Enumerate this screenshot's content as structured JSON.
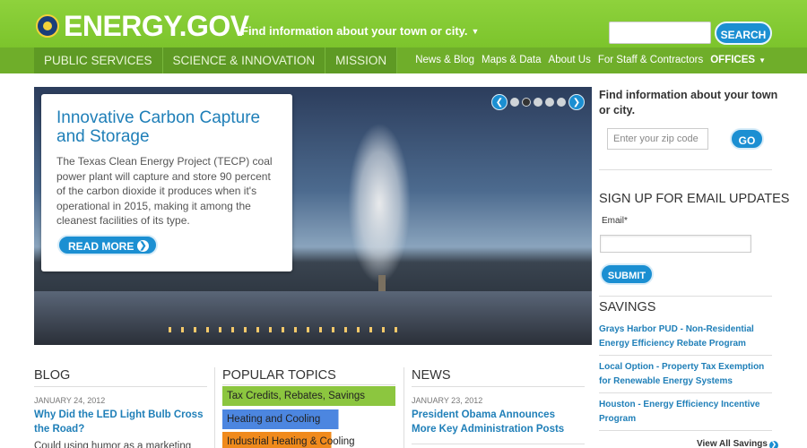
{
  "colors": {
    "brand_green": "#8cc63f",
    "nav_green": "#6fae2a",
    "link_blue": "#1f7fb8",
    "button_blue": "#1b8fd2",
    "topic_green": "#8cc63f",
    "topic_blue": "#4c86e0",
    "topic_orange": "#f08a1c"
  },
  "header": {
    "logo": "ENERGY.GOV",
    "find_town": "Find information about your town or city.",
    "search_button": "SEARCH"
  },
  "nav": {
    "primary": [
      "PUBLIC SERVICES",
      "SCIENCE & INNOVATION",
      "MISSION"
    ],
    "secondary": [
      "News & Blog",
      "Maps & Data",
      "About Us",
      "For Staff & Contractors"
    ],
    "offices": "OFFICES"
  },
  "hero": {
    "title": "Innovative Carbon Capture and Storage",
    "body": "The Texas Clean Energy Project (TECP) coal power plant will capture and store 90 percent of the carbon dioxide it produces when it's operational in 2015, making it among the cleanest facilities of its type.",
    "read_more": "READ MORE",
    "slide_count": 5,
    "active_slide": 2
  },
  "sidebar": {
    "zip_question": "Find information about your town or city.",
    "zip_placeholder": "Enter your zip code",
    "go_button": "GO",
    "signup_title": "SIGN UP FOR EMAIL UPDATES",
    "email_label": "Email*",
    "submit_button": "SUBMIT",
    "savings_title": "SAVINGS",
    "savings_items": [
      "Grays Harbor PUD - Non-Residential Energy Efficiency Rebate Program",
      "Local Option - Property Tax Exemption for Renewable Energy Systems",
      "Houston - Energy Efficiency Incentive Program"
    ],
    "view_all": "View All Savings"
  },
  "blog": {
    "title": "BLOG",
    "date": "JANUARY 24, 2012",
    "headline": "Why Did the LED Light Bulb Cross the Road?",
    "body": "Could using humor as a marketing"
  },
  "topics": {
    "title": "POPULAR TOPICS",
    "items": [
      {
        "label": "Tax Credits, Rebates, Savings",
        "value": 1.0
      },
      {
        "label": "Heating and Cooling",
        "value": 0.67
      },
      {
        "label": "Industrial Heating & Cooling",
        "value": 0.63
      }
    ]
  },
  "news": {
    "title": "NEWS",
    "date": "JANUARY 23, 2012",
    "headline": "President Obama Announces More Key Administration Posts"
  }
}
